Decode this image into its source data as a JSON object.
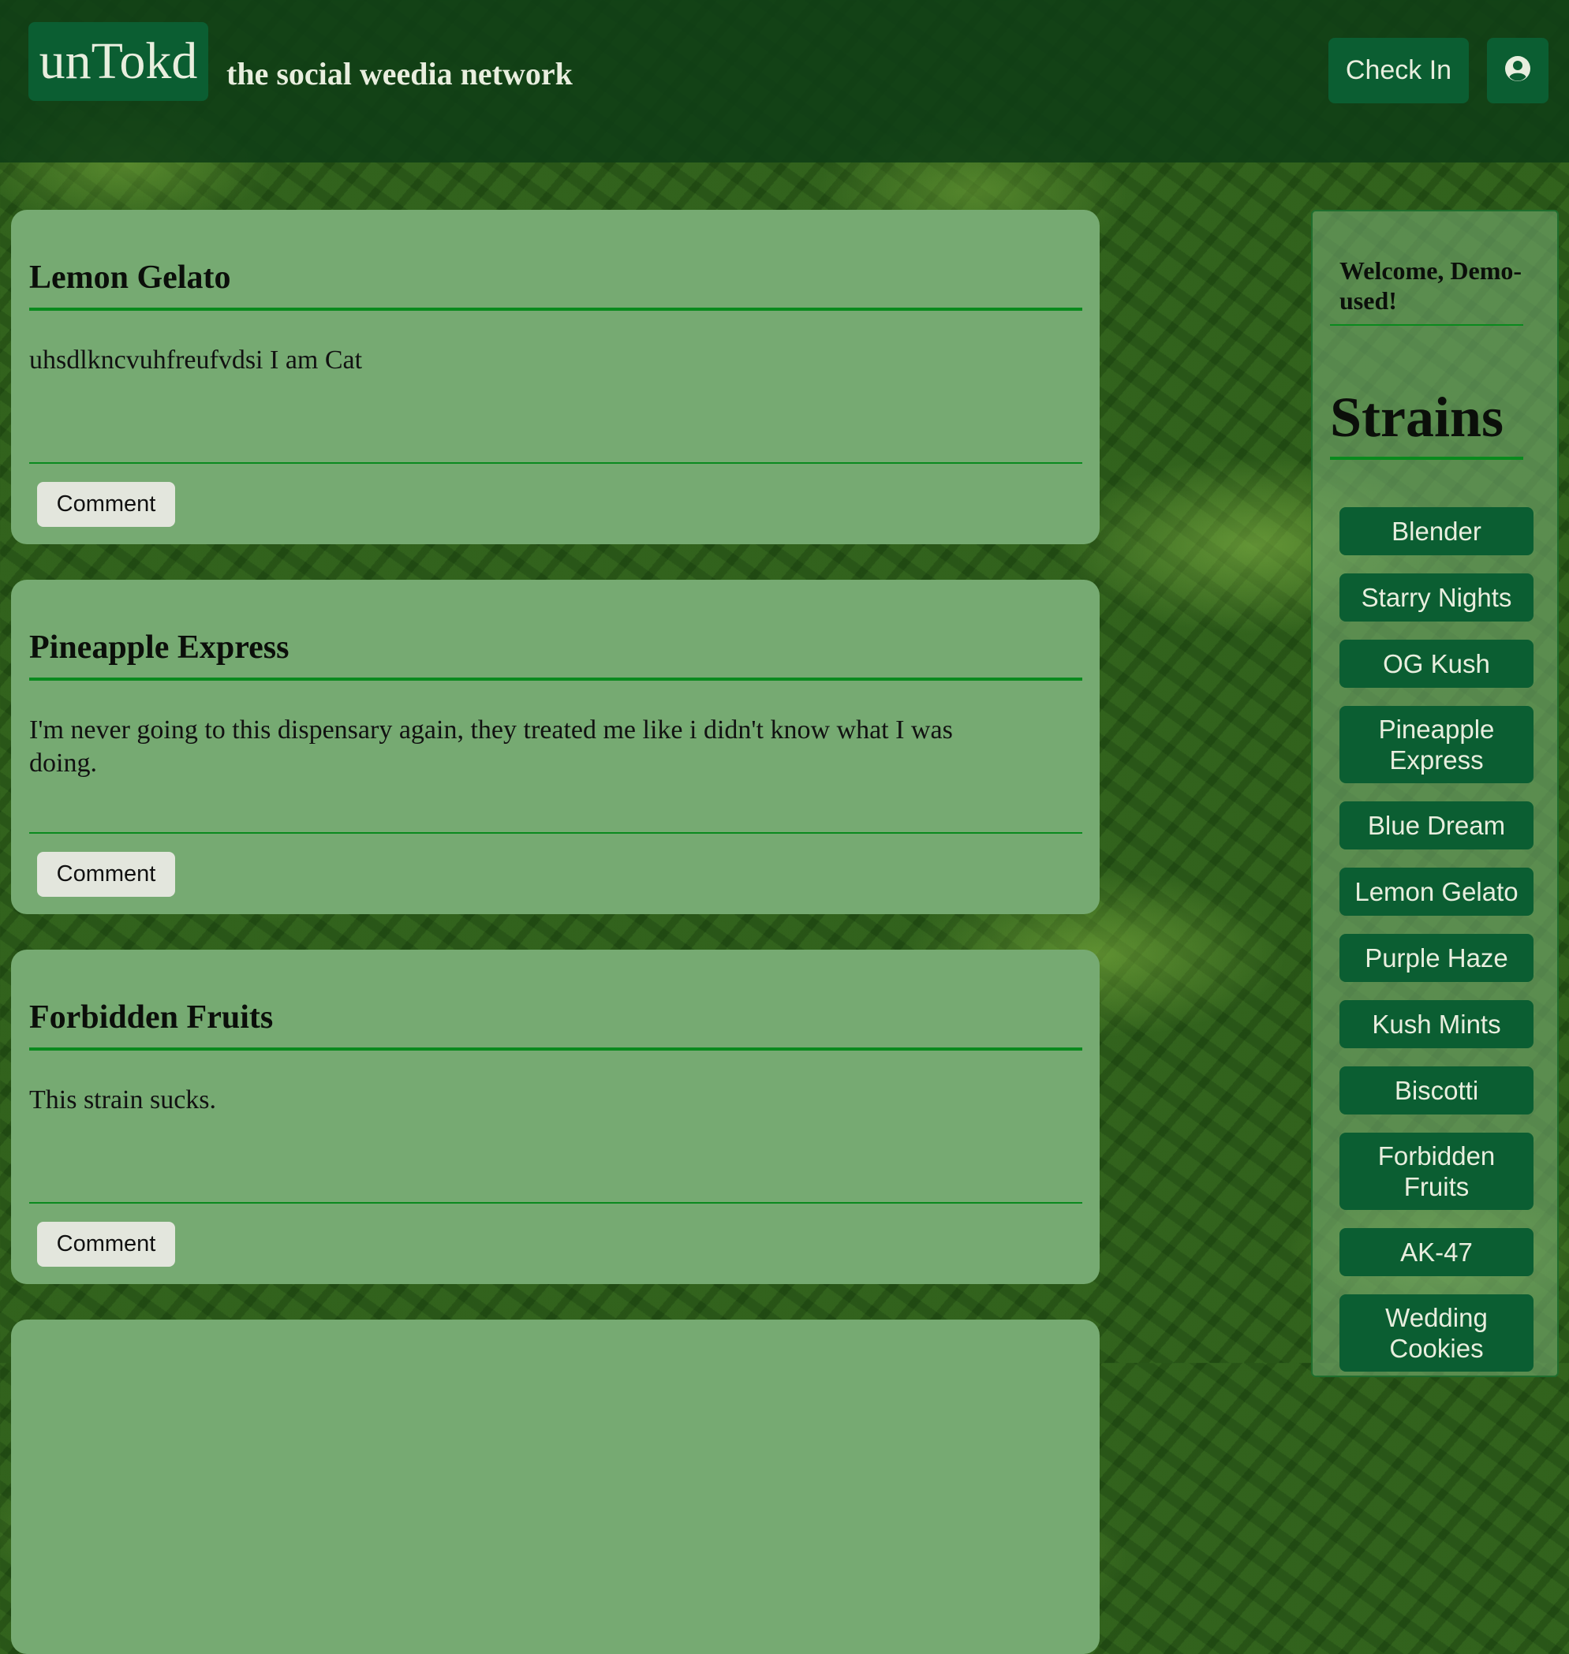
{
  "header": {
    "logo": "unTokd",
    "tagline": "the social weedia network",
    "check_in_label": "Check In",
    "profile_icon": "user-circle-icon"
  },
  "feed": [
    {
      "title": "Lemon Gelato",
      "body": "uhsdlkncvuhfreufvdsi I am Cat",
      "comment_label": "Comment"
    },
    {
      "title": "Pineapple Express",
      "body": "I'm never going to this dispensary again, they treated me like i didn't know what I was doing.",
      "comment_label": "Comment"
    },
    {
      "title": "Forbidden Fruits",
      "body": "This strain sucks.",
      "comment_label": "Comment"
    },
    {
      "title": "",
      "body": "",
      "comment_label": ""
    }
  ],
  "sidebar": {
    "welcome": "Welcome, Demo-used!",
    "strains_heading": "Strains",
    "strains": [
      "Blender",
      "Starry Nights",
      "OG Kush",
      "Pineapple Express",
      "Blue Dream",
      "Lemon Gelato",
      "Purple Haze",
      "Kush Mints",
      "Biscotti",
      "Forbidden Fruits",
      "AK-47",
      "Wedding Cookies"
    ]
  },
  "colors": {
    "brand_dark_green": "#0b5e32",
    "card_green": "#76aa72",
    "accent_green": "#0a8a1e",
    "header_bg": "#0f3e16",
    "text_light": "#e8eede"
  }
}
